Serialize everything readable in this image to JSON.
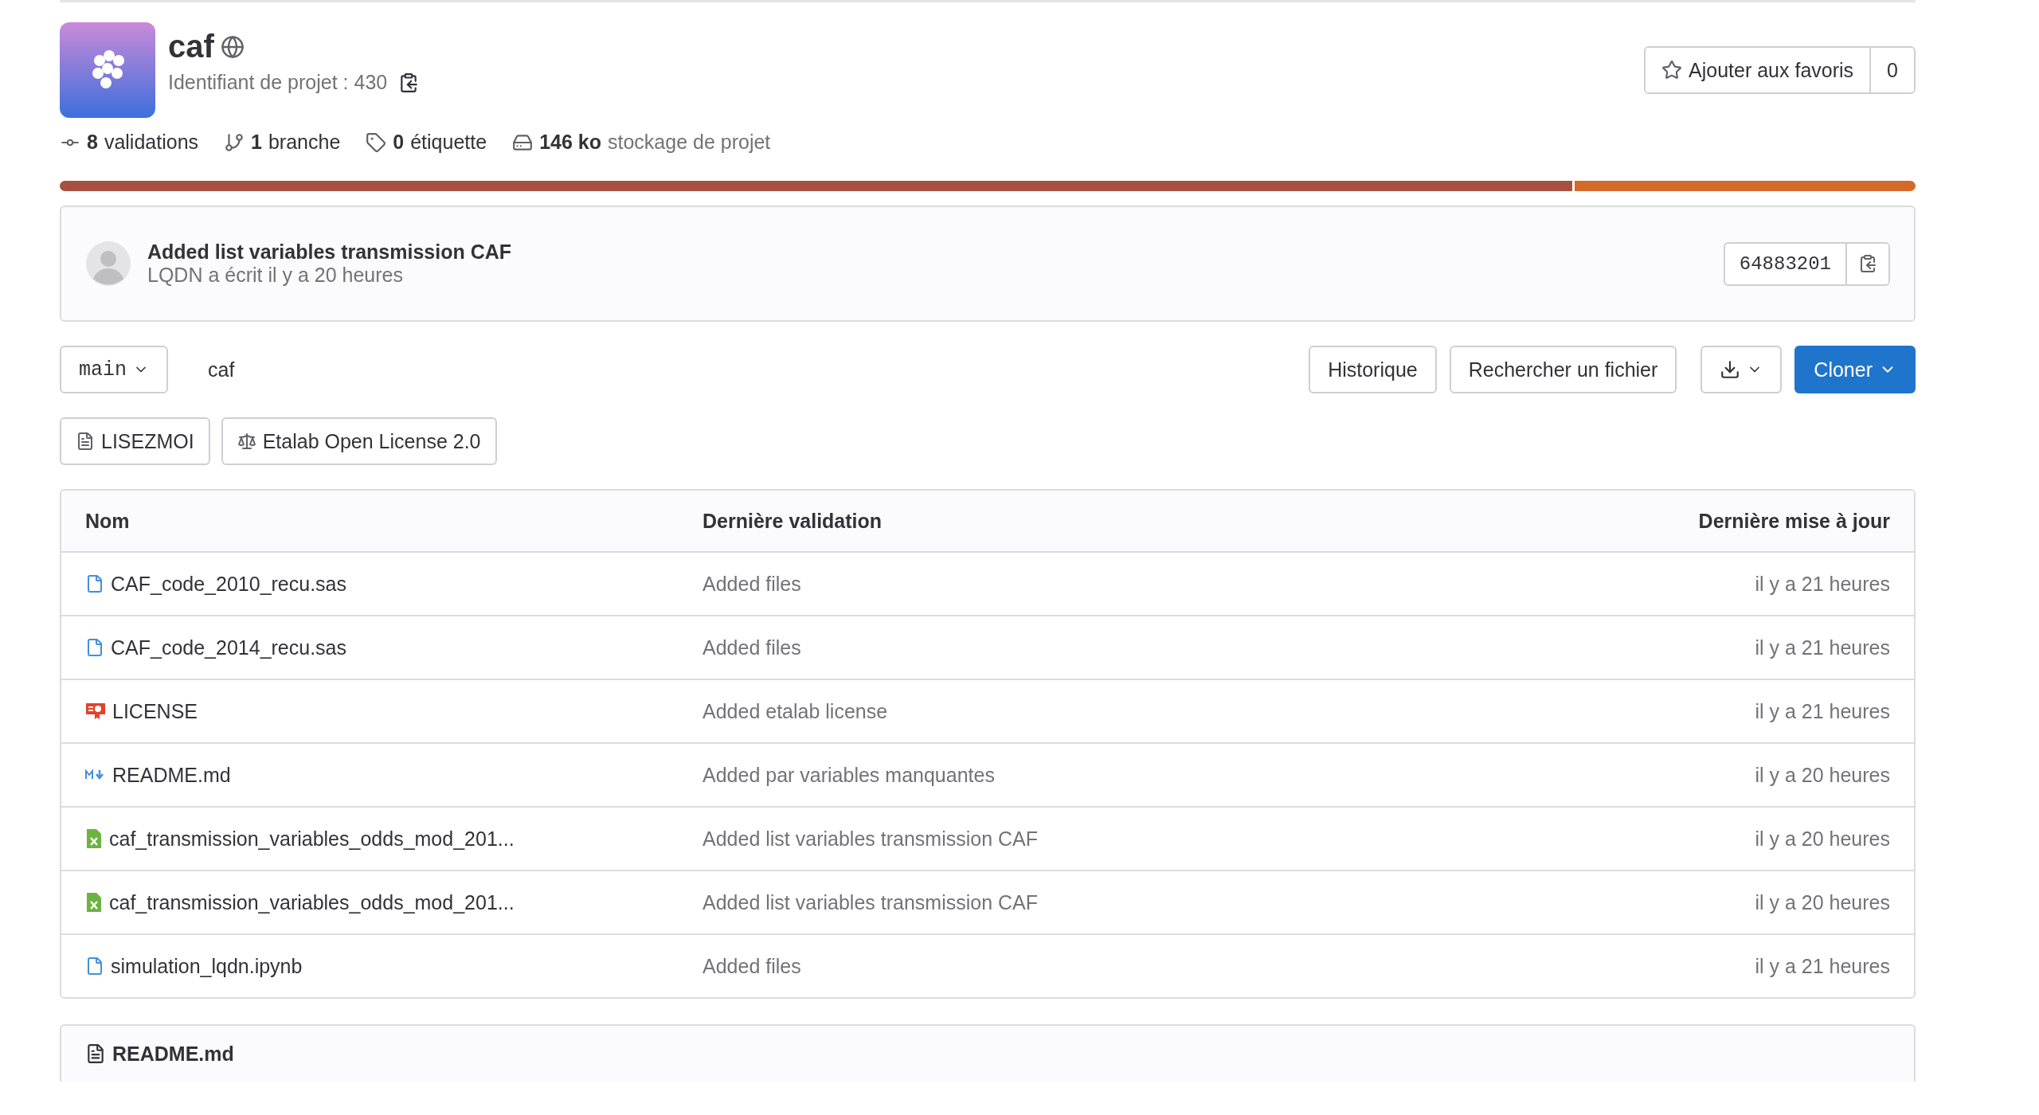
{
  "project": {
    "name": "caf",
    "id_label": "Identifiant de projet : 430"
  },
  "star": {
    "label": "Ajouter aux favoris",
    "count": "0"
  },
  "stats": [
    {
      "kind": "commits",
      "value": "8",
      "label": "validations"
    },
    {
      "kind": "branches",
      "value": "1",
      "label": "branche"
    },
    {
      "kind": "tags",
      "value": "0",
      "label": "étiquette"
    },
    {
      "kind": "storage",
      "value": "146 ko",
      "label": "stockage de projet"
    }
  ],
  "language_bar": [
    {
      "color": "#a8503f",
      "level": 0.816
    },
    {
      "color": "#d4692a",
      "level": 0.184
    }
  ],
  "last_commit": {
    "title": "Added list variables transmission CAF",
    "meta": "LQDN a écrit il y a 20 heures",
    "sha": "64883201"
  },
  "toolbar": {
    "branch": "main",
    "path": "caf",
    "buttons": [
      "Historique",
      "Rechercher un fichier"
    ],
    "clone": "Cloner"
  },
  "badges": [
    {
      "kind": "readme",
      "label": "LISEZMOI"
    },
    {
      "kind": "license",
      "label": "Etalab Open License 2.0"
    }
  ],
  "table": {
    "columns": [
      "Nom",
      "Dernière validation",
      "Dernière mise à jour"
    ],
    "rows": [
      {
        "kind": "file",
        "name": "CAF_code_2010_recu.sas",
        "commit": "Added files",
        "updated": "il y a 21 heures"
      },
      {
        "kind": "file",
        "name": "CAF_code_2014_recu.sas",
        "commit": "Added files",
        "updated": "il y a 21 heures"
      },
      {
        "kind": "license",
        "name": "LICENSE",
        "commit": "Added etalab license",
        "updated": "il y a 21 heures"
      },
      {
        "kind": "markdown",
        "name": "README.md",
        "commit": "Added par variables manquantes",
        "updated": "il y a 20 heures"
      },
      {
        "kind": "spreadsheet",
        "name": "caf_transmission_variables_odds_mod_201...",
        "commit": "Added list variables transmission CAF",
        "updated": "il y a 20 heures"
      },
      {
        "kind": "spreadsheet",
        "name": "caf_transmission_variables_odds_mod_201...",
        "commit": "Added list variables transmission CAF",
        "updated": "il y a 20 heures"
      },
      {
        "kind": "file",
        "name": "simulation_lqdn.ipynb",
        "commit": "Added files",
        "updated": "il y a 21 heures"
      }
    ]
  },
  "readme": {
    "title": "README.md"
  }
}
